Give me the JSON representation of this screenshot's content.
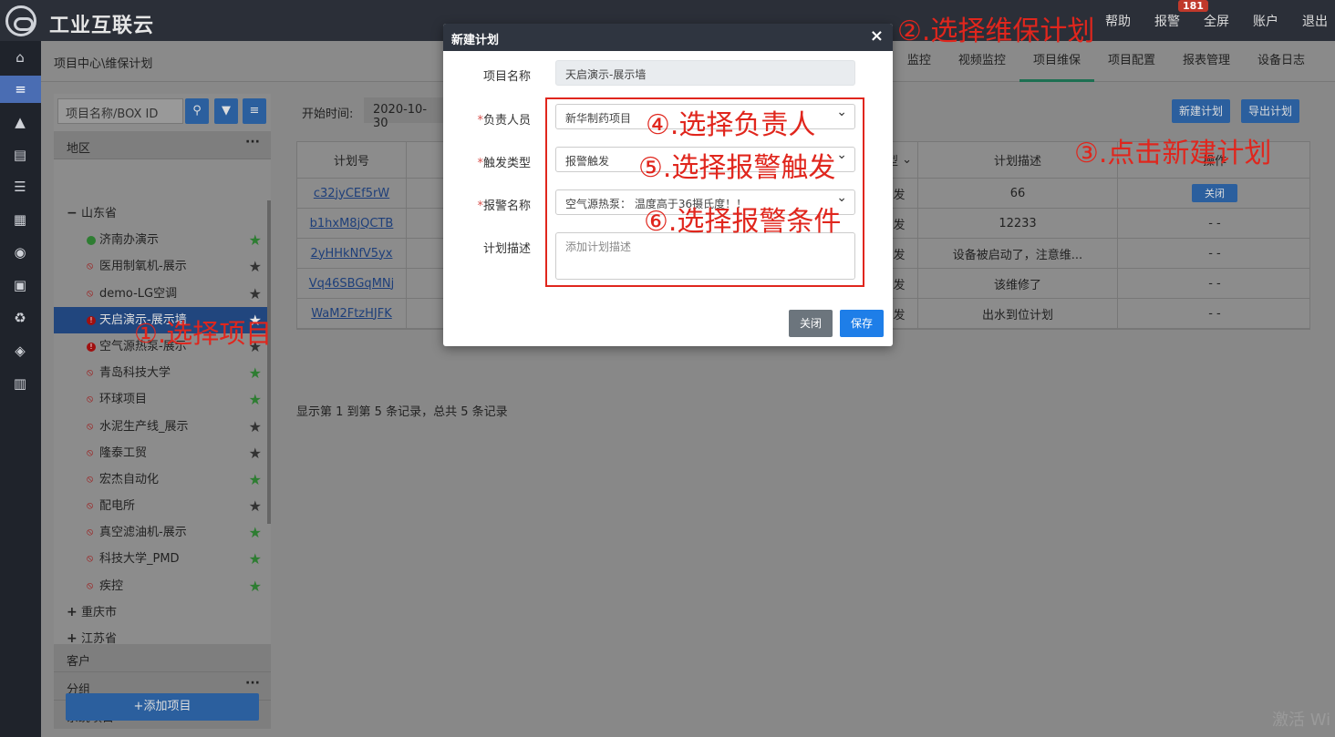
{
  "app": {
    "brand": "工业互联云"
  },
  "topnav": {
    "items": [
      "帮助",
      "报警",
      "全屏",
      "账户",
      "退出"
    ],
    "alarm_badge": "181"
  },
  "breadcrumb": "项目中心\\维保计划",
  "tabs": [
    "监控",
    "视频监控",
    "项目维保",
    "项目配置",
    "报表管理",
    "设备日志"
  ],
  "active_tab": "项目维保",
  "left_panel": {
    "search_placeholder": "项目名称/BOX ID",
    "region_label": "地区",
    "province": "山东省",
    "projects": [
      {
        "name": "济南办演示",
        "status": "green",
        "star": "green"
      },
      {
        "name": "医用制氧机-展示",
        "status": "link",
        "star": "dark"
      },
      {
        "name": "demo-LG空调",
        "status": "link",
        "star": "dark"
      },
      {
        "name": "天启演示-展示墙",
        "status": "alert",
        "star": "white",
        "selected": true
      },
      {
        "name": "空气源热泵-展示",
        "status": "alert",
        "star": "dark"
      },
      {
        "name": "青岛科技大学",
        "status": "link",
        "star": "green"
      },
      {
        "name": "环球项目",
        "status": "link",
        "star": "green"
      },
      {
        "name": "水泥生产线_展示",
        "status": "link",
        "star": "dark"
      },
      {
        "name": "隆泰工贸",
        "status": "link",
        "star": "dark"
      },
      {
        "name": "宏杰自动化",
        "status": "link",
        "star": "green"
      },
      {
        "name": "配电所",
        "status": "link",
        "star": "dark"
      },
      {
        "name": "真空滤油机-展示",
        "status": "link",
        "star": "green"
      },
      {
        "name": "科技大学_PMD",
        "status": "link",
        "star": "green"
      },
      {
        "name": "疾控",
        "status": "link",
        "star": "green"
      }
    ],
    "other_regions": [
      "重庆市",
      "江苏省"
    ],
    "customer_label": "客户",
    "group_label": "分组",
    "system_label": "系统项目",
    "add_button": "+添加项目"
  },
  "filter": {
    "label": "开始时间:",
    "value": "2020-10-30"
  },
  "actions": {
    "new_plan": "新建计划",
    "export_plan": "导出计划"
  },
  "table": {
    "col_plan": "计划号",
    "col_type_tail": "型",
    "col_desc": "计划描述",
    "col_op": "操作",
    "rows": [
      {
        "id": "c32jyCEf5rW",
        "type_tail": "发",
        "desc": "66",
        "op": "关闭"
      },
      {
        "id": "b1hxM8jQCTB",
        "type_tail": "发",
        "desc": "12233",
        "op": "- -"
      },
      {
        "id": "2yHHkNfV5yx",
        "type_tail": "发",
        "desc": "设备被启动了，注意维...",
        "op": "- -"
      },
      {
        "id": "Vq46SBGqMNj",
        "type_tail": "发",
        "desc": "该维修了",
        "op": "- -"
      },
      {
        "id": "WaM2FtzHJFK",
        "type_tail": "发",
        "desc": "出水到位计划",
        "op": "- -"
      }
    ],
    "summary": "显示第 1 到第 5 条记录，总共 5 条记录"
  },
  "modal": {
    "title": "新建计划",
    "close_icon": "×",
    "project_label": "项目名称",
    "project_value": "天启演示-展示墙",
    "owner_label": "负责人员",
    "owner_value": "新华制药项目",
    "trigger_label": "触发类型",
    "trigger_value": "报警触发",
    "alarm_label": "报警名称",
    "alarm_value": "空气源热泵：  温度高于36摄氏度！！",
    "desc_label": "计划描述",
    "desc_placeholder": "添加计划描述",
    "close_button": "关闭",
    "save_button": "保存"
  },
  "annotations": {
    "a1": "①.选择项目",
    "a2": "②.选择维保计划",
    "a3": "③.点击新建计划",
    "a4": "④.选择负责人",
    "a5": "⑤.选择报警触发",
    "a6": "⑥.选择报警条件",
    "color": "#e0261d"
  },
  "watermark": "激活 Wi"
}
